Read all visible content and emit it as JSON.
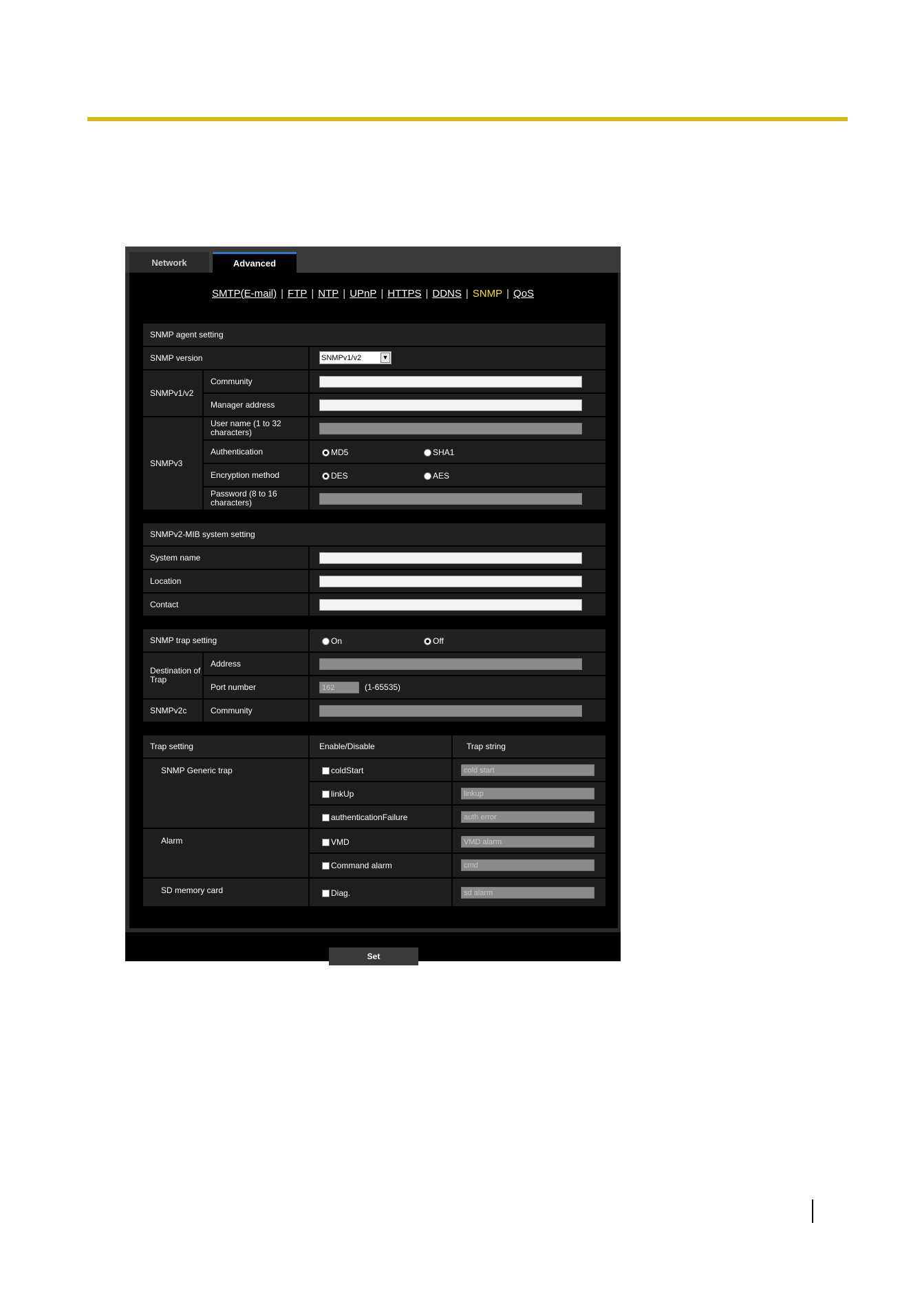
{
  "tabs": {
    "network": "Network",
    "advanced": "Advanced"
  },
  "subnav": {
    "smtp": "SMTP(E-mail)",
    "ftp": "FTP",
    "ntp": "NTP",
    "upnp": "UPnP",
    "https": "HTTPS",
    "ddns": "DDNS",
    "snmp": "SNMP",
    "qos": "QoS",
    "sep": "|"
  },
  "agent": {
    "header": "SNMP agent setting",
    "version_label": "SNMP version",
    "version_value": "SNMPv1/v2",
    "v1v2_label": "SNMPv1/v2",
    "community_label": "Community",
    "manager_label": "Manager address",
    "v3_label": "SNMPv3",
    "username_label": "User name (1 to 32 characters)",
    "auth_label": "Authentication",
    "auth_md5": "MD5",
    "auth_sha1": "SHA1",
    "enc_label": "Encryption method",
    "enc_des": "DES",
    "enc_aes": "AES",
    "password_label": "Password (8 to 16 characters)"
  },
  "mib": {
    "header": "SNMPv2-MIB system setting",
    "system_name": "System name",
    "location": "Location",
    "contact": "Contact"
  },
  "trap": {
    "label": "SNMP trap setting",
    "on": "On",
    "off": "Off",
    "dest_label": "Destination of Trap",
    "address_label": "Address",
    "port_label": "Port number",
    "port_value": "162",
    "port_range": "(1-65535)",
    "v2c_label": "SNMPv2c",
    "community_label": "Community"
  },
  "trapset": {
    "header": "Trap setting",
    "col_enable": "Enable/Disable",
    "col_string": "Trap string",
    "generic_label": "SNMP Generic trap",
    "coldstart": "coldStart",
    "coldstart_str": "cold start",
    "linkup": "linkUp",
    "linkup_str": "linkup",
    "authfail": "authenticationFailure",
    "authfail_str": "auth error",
    "alarm_label": "Alarm",
    "vmd": "VMD",
    "vmd_str": "VMD alarm",
    "cmdalarm": "Command alarm",
    "cmdalarm_str": "cmd",
    "sd_label": "SD memory card",
    "diag": "Diag.",
    "diag_str": "sd alarm"
  },
  "set_label": "Set"
}
